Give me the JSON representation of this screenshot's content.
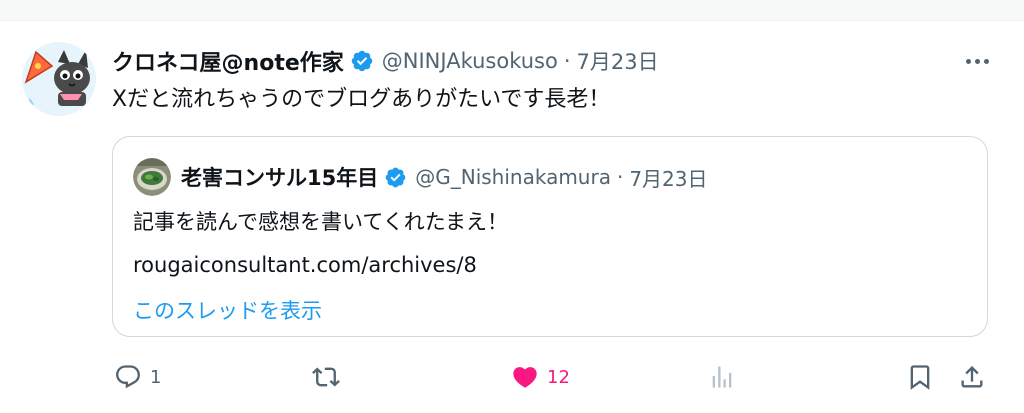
{
  "post": {
    "author": {
      "name": "クロネコ屋@note作家",
      "handle": "@NINJAkusokuso",
      "date": "7月23日",
      "avatar_icon": "black-cat-avatar-icon"
    },
    "text": "Xだと流れちゃうのでブログありがたいです長老！",
    "menu_icon": "more-icon"
  },
  "quote": {
    "author": {
      "name": "老害コンサル15年目",
      "handle": "@G_Nishinakamura",
      "date": "7月23日",
      "avatar_icon": "food-photo-avatar-icon"
    },
    "line1": "記事を読んで感想を書いてくれたまえ！",
    "line2": "rougaiconsultant.com/archives/8",
    "show_thread": "このスレッドを表示"
  },
  "actions": {
    "reply": {
      "icon": "reply-icon",
      "count": "1"
    },
    "repost": {
      "icon": "repost-icon",
      "count": ""
    },
    "like": {
      "icon": "heart-icon",
      "count": "12",
      "liked": true
    },
    "views": {
      "icon": "analytics-icon",
      "count": ""
    },
    "bookmark": {
      "icon": "bookmark-icon"
    },
    "share": {
      "icon": "share-icon"
    }
  },
  "colors": {
    "verified": "#1d9bf0",
    "like": "#f91880",
    "muted": "#536471",
    "link": "#1d9bf0"
  },
  "separator": "·"
}
